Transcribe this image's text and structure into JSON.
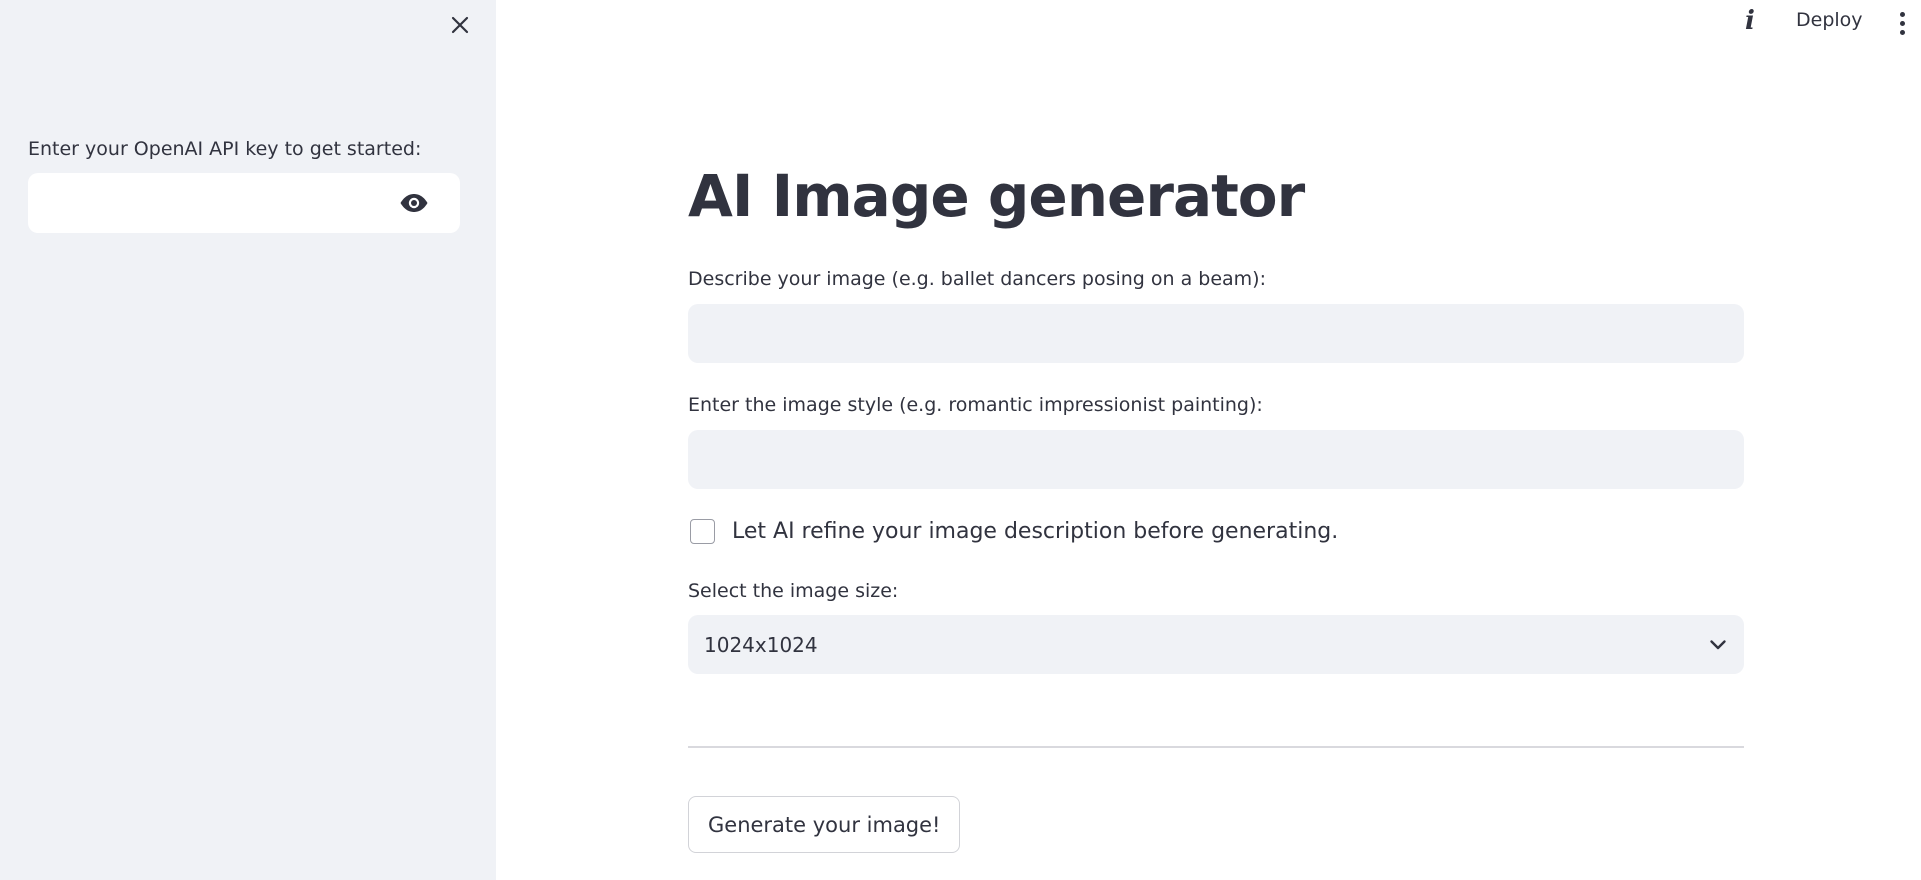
{
  "sidebar": {
    "api_key_label": "Enter your OpenAI API key to get started:",
    "api_key_value": "",
    "close_icon": "close-icon",
    "visibility_icon": "eye-icon",
    "background": "#f0f2f6"
  },
  "topbar": {
    "info_icon": "i",
    "deploy_label": "Deploy",
    "menu_icon": "vertical-dots-icon"
  },
  "main": {
    "title": "AI Image generator",
    "description": {
      "label": "Describe your image (e.g. ballet dancers posing on a beam):",
      "value": ""
    },
    "style": {
      "label": "Enter the image style (e.g. romantic impressionist painting):",
      "value": ""
    },
    "refine_checkbox": {
      "label": "Let AI refine your image description before generating.",
      "checked": false
    },
    "size_select": {
      "label": "Select the image size:",
      "selected": "1024x1024"
    },
    "generate_button": "Generate your image!"
  },
  "colors": {
    "text": "#31333f",
    "input_background": "#f0f2f6",
    "page_background": "#ffffff"
  }
}
